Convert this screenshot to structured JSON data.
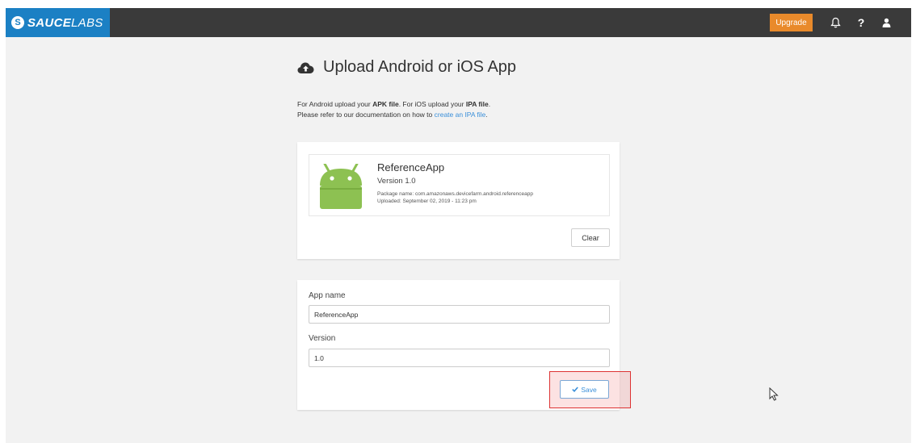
{
  "topbar": {
    "logo_mark": "S",
    "logo_bold": "SAUCE",
    "logo_light": "LABS",
    "upgrade_label": "Upgrade",
    "help_label": "?"
  },
  "page": {
    "title": "Upload Android or iOS App",
    "intro": {
      "line1_a": "For Android upload your ",
      "line1_apk": "APK file",
      "line1_b": ". For iOS upload your ",
      "line1_ipa": "IPA file",
      "line1_c": ".",
      "line2_a": "Please refer to our documentation on how to ",
      "line2_link": "create an IPA file",
      "line2_b": "."
    }
  },
  "app_card": {
    "name": "ReferenceApp",
    "version": "Version 1.0",
    "package": "Package name: com.amazonaws.devicefarm.android.referenceapp",
    "uploaded": "Uploaded: September 02, 2019 - 11:23 pm",
    "clear_label": "Clear"
  },
  "form": {
    "app_name_label": "App name",
    "app_name_value": "ReferenceApp",
    "version_label": "Version",
    "version_value": "1.0",
    "save_label": "Save"
  },
  "colors": {
    "logo_bg": "#1b80c4",
    "topbar_bg": "#3a3a3a",
    "upgrade": "#e98a2b",
    "android": "#8dc152",
    "link": "#3a8fd9"
  }
}
